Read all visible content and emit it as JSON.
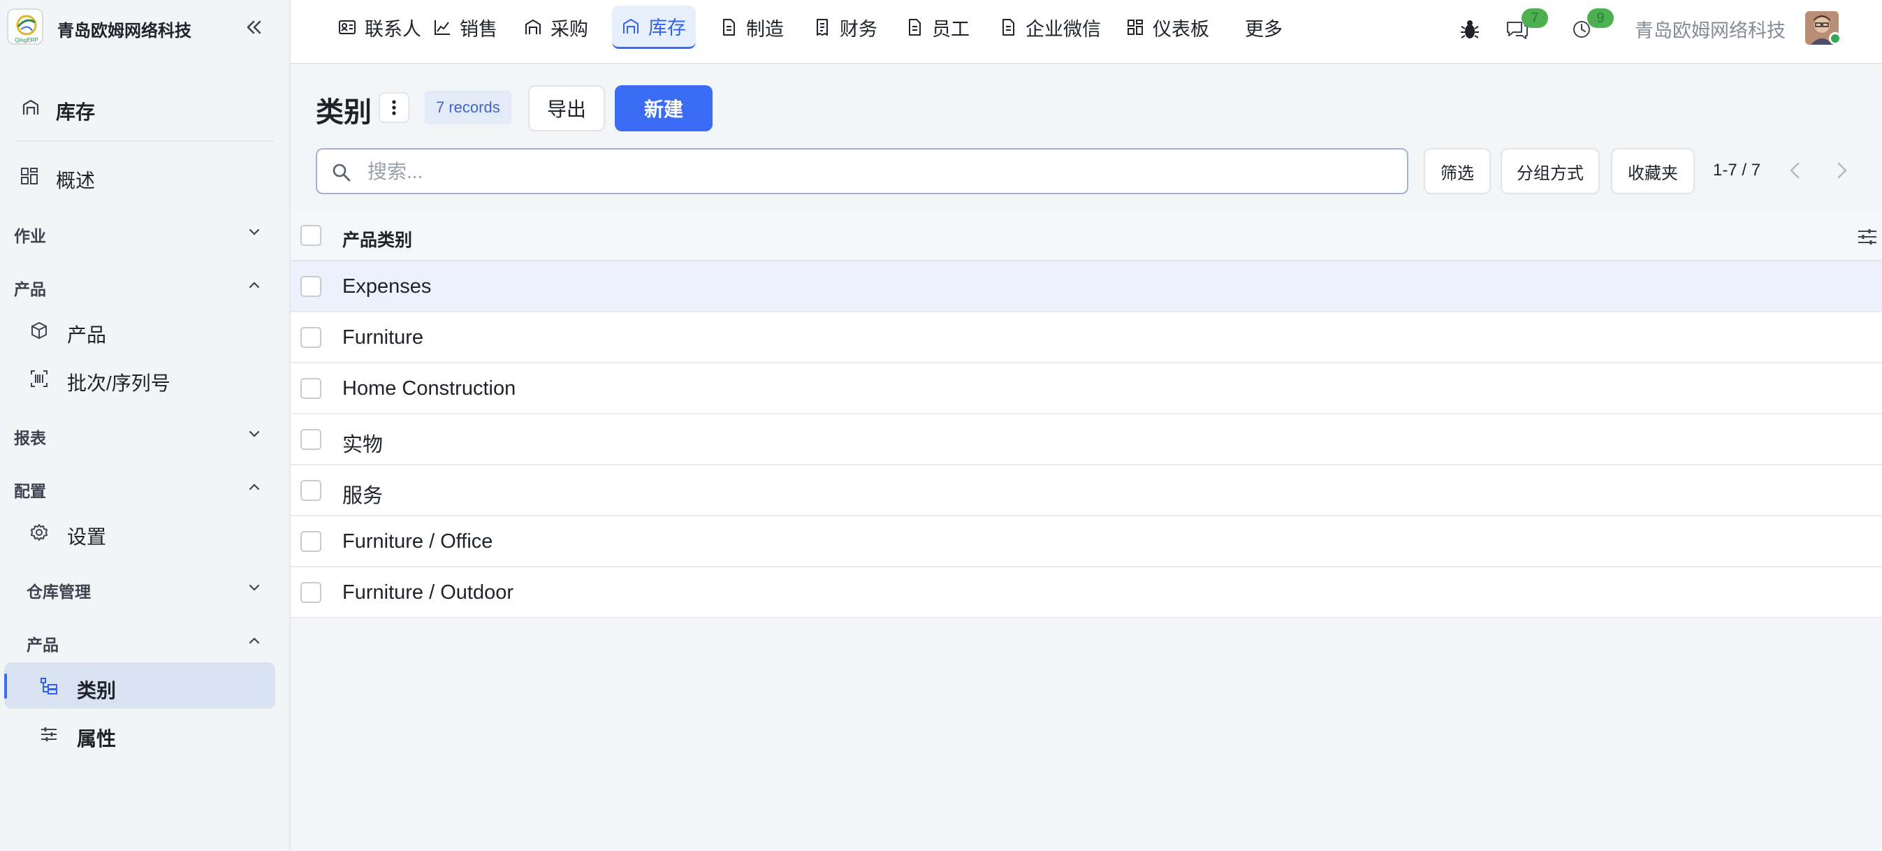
{
  "company": "青岛欧姆网络科技",
  "brand": {
    "name": "青岛欧姆网络科技",
    "logo_text": "QingERP"
  },
  "sidebar": {
    "app_title": "库存",
    "overview": "概述",
    "sections": {
      "operations": "作业",
      "products": "产品",
      "reports": "报表",
      "configuration": "配置",
      "warehouse": "仓库管理",
      "config_products": "产品"
    },
    "items": {
      "products": "产品",
      "lots": "批次/序列号",
      "settings": "设置",
      "categories": "类别",
      "attributes": "属性"
    }
  },
  "topnav": {
    "items": [
      "联系人",
      "销售",
      "采购",
      "库存",
      "制造",
      "财务",
      "员工",
      "企业微信",
      "仪表板",
      "更多"
    ],
    "active": "库存",
    "messages_count": "7",
    "activities_count": "9"
  },
  "control": {
    "title": "类别",
    "records": "7 records",
    "export_label": "导出",
    "new_label": "新建",
    "search_placeholder": "搜索...",
    "filter_label": "筛选",
    "group_label": "分组方式",
    "favorites_label": "收藏夹",
    "pager": "1-7 / 7"
  },
  "table": {
    "header": "产品类别",
    "rows": [
      "Expenses",
      "Furniture",
      "Home Construction",
      "实物",
      "服务",
      "Furniture / Office",
      "Furniture / Outdoor"
    ]
  },
  "colors": {
    "accent": "#3b6cf6",
    "badge": "#4caf50",
    "sidebar_bg": "#f2f4f6",
    "active_item_bg": "#d8e2f0"
  }
}
